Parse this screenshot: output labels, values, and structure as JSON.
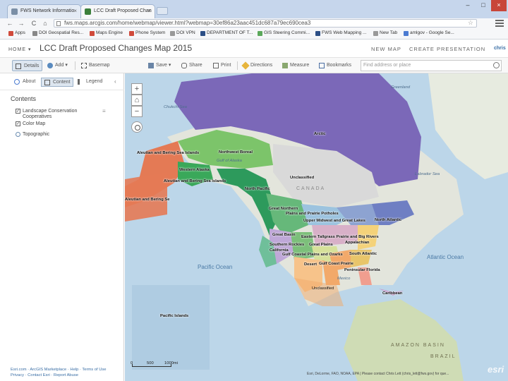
{
  "browser": {
    "tabs": [
      {
        "title": "FWS Network Informatio",
        "fav_color": "#7b8fa6"
      },
      {
        "title": "LCC Draft Proposed Chan",
        "fav_color": "#3b7f3b"
      }
    ],
    "url": "fws.maps.arcgis.com/home/webmap/viewer.html?webmap=30ef86a23aac451dc687a79ec690cea3",
    "bookmarks": [
      {
        "label": "Apps",
        "color": "#d04a3b"
      },
      {
        "label": "DOI Geospatial Res...",
        "color": "#888"
      },
      {
        "label": "Maps Engine",
        "color": "#d04a3b"
      },
      {
        "label": "Phone System",
        "color": "#d04a3b"
      },
      {
        "label": "DOI VPN",
        "color": "#999"
      },
      {
        "label": "DEPARTMENT OF T...",
        "color": "#2c4f86"
      },
      {
        "label": "GIS Steering Commi...",
        "color": "#5ba85b"
      },
      {
        "label": "FWS Web Mapping ...",
        "color": "#2c4f86"
      },
      {
        "label": "New Tab",
        "color": "#999"
      },
      {
        "label": "amlgov - Google Se...",
        "color": "#4b7bd1"
      }
    ]
  },
  "header": {
    "home": "HOME ▾",
    "title": "LCC Draft Proposed Changes Map 2015",
    "new_map": "NEW MAP",
    "create_presentation": "CREATE PRESENTATION",
    "user": "chris"
  },
  "toolbar": {
    "details": "Details",
    "add": "Add ▾",
    "basemap": "Basemap",
    "save": "Save ▾",
    "share": "Share",
    "print": "Print",
    "directions": "Directions",
    "measure": "Measure",
    "bookmarks": "Bookmarks",
    "search_placeholder": "Find address or place"
  },
  "sidebar": {
    "about": "About",
    "content": "Content",
    "legend": "Legend",
    "contents_title": "Contents",
    "layers": [
      {
        "label": "Landscape Conservation Cooperatives",
        "checked": true
      },
      {
        "label": "Color Map",
        "checked": true
      },
      {
        "label": "Topographic",
        "checked": false
      }
    ],
    "footer_line1": "Esri.com  ·  ArcGIS Marketplace  ·  Help  ·  Terms of Use",
    "footer_line2": "Privacy  ·  Contact Esri  ·  Report Abuse"
  },
  "map": {
    "regions": [
      "Arctic",
      "Aleutian and Bering Sea Islands",
      "Northwest Boreal",
      "Western Alaska",
      "Aleutian and Bering Sea Islands",
      "Unclassified",
      "North Pacific",
      "Great Northern",
      "Plains and Prairie Potholes",
      "Upper Midwest and Great Lakes",
      "North Atlantic",
      "Great Basin",
      "Eastern Tallgrass Prairie and Big Rivers",
      "Appalachian",
      "Southern Rockies",
      "Great Plains",
      "California",
      "Gulf Coastal Plains and Ozarks",
      "South Atlantic",
      "Desert",
      "Gulf Coast Prairie",
      "Peninsular Florida",
      "Unclassified",
      "Caribbean",
      "Pacific Islands",
      "Aleutian and Bering Se"
    ],
    "geo_labels": {
      "greenland": "Greenland",
      "labrador_sea": "Labrador Sea",
      "gulf_alaska": "Gulf of Alaska",
      "canada": "CANADA",
      "pacific": "Pacific Ocean",
      "atlantic": "Atlantic Ocean",
      "mexico": "Mexico",
      "amazon": "AMAZON BASIN",
      "brazil": "BRAZIL",
      "chukchi": "Chukchi Sea"
    },
    "scale_0": "0",
    "scale_500": "500",
    "scale_1000": "1000mi",
    "attribution": "Esri, DeLorme, FAO, NOAA, EPA | Please contact Chris Lett (chris_lett@fws.gov) for que...",
    "logo": "esri",
    "colors": {
      "arctic": "#7b68b8",
      "aleutian": "#e47a55",
      "northwest_boreal": "#7cc46a",
      "western_alaska": "#3aa85a",
      "unclassified": "#d9d9d9",
      "north_pacific": "#2d9a5c",
      "great_northern": "#66b87a",
      "plains_prairie": "#9cc3df",
      "upper_midwest": "#8da3d1",
      "north_atlantic": "#6f7fc3",
      "great_basin": "#bfa8d8",
      "eastern_tallgrass": "#d8b0c8",
      "appalachian": "#f4d27a",
      "southern_rockies": "#7cbf7a",
      "california": "#6fbf9a",
      "gulf_coastal": "#f2a96a",
      "south_atlantic": "#e8c56a",
      "desert": "#f7c38a",
      "great_plains": "#d6e19a",
      "florida": "#f09e8f"
    }
  }
}
